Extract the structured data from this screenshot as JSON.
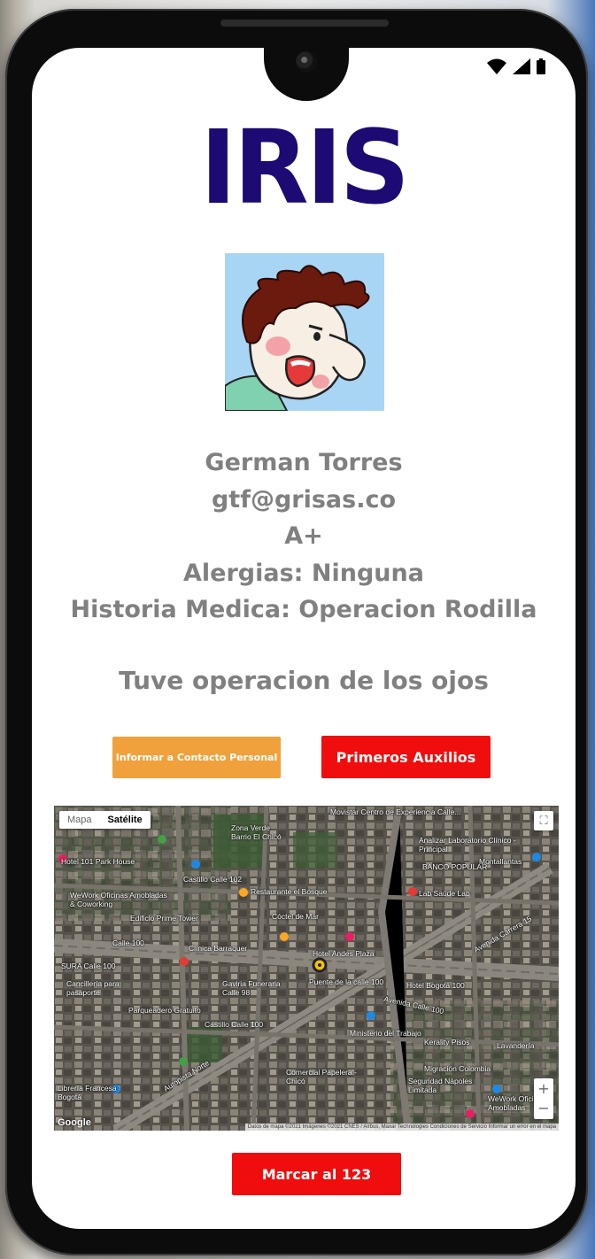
{
  "status_bar": {
    "icons": [
      "wifi-icon",
      "signal-icon",
      "battery-icon"
    ]
  },
  "app": {
    "title": "IRIS",
    "title_color": "#1d0a73"
  },
  "profile": {
    "name": "German Torres",
    "email": "gtf@grisas.co",
    "blood_type": "A+",
    "allergies": "Alergias: Ninguna",
    "medical_history": "Historia Medica: Operacion Rodilla",
    "note": "Tuve operacion de los ojos"
  },
  "actions": {
    "contact_label": "Informar a Contacto Personal",
    "contact_color": "#f0a13b",
    "first_aid_label": "Primeros Auxilios",
    "first_aid_color": "#f00d0d",
    "call_label": "Marcar al 123",
    "call_color": "#f00d0d"
  },
  "map": {
    "tab_map": "Mapa",
    "tab_satellite": "Satélite",
    "zoom_in": "+",
    "zoom_out": "−",
    "provider": "Google",
    "attribution": "Datos de mapa ©2021 Imágenes ©2021 CNES / Airbus, Maxar Technologies   Condiciones de Servicio   Informar un error en el mapa",
    "labels": [
      "Movistar Centro de Experiencia Calle...",
      "Hotel 101 Park House",
      "Zona Verde Barrio El Chicó",
      "Analizar Laboratorio Clínico - Principal",
      "BANCO POPULAR",
      "Montallantas",
      "Castillo Calle 102",
      "WeWork Oficinas Amobladas & Coworking",
      "Restaurante el Bosque",
      "Edificio Prime Tower",
      "Cóctel de Mar",
      "Clínica Barraquer",
      "SURA Calle 100",
      "Hotel Andes Plaza",
      "Puente de la calle 100",
      "Cancillería para pasaporte",
      "Gaviria Funeraria Calle 98",
      "Parqueadero Gratuito",
      "Hotel Bogotá 100",
      "Avenida Calle 100",
      "Ministerio del Trabajo",
      "Castillo Calle 100",
      "Kerality Pisos",
      "Migración Colombia",
      "Seguridad Nápoles Limitada",
      "Comercial Papelera - Chicó",
      "Librería Francesa Bogotá",
      "WeWork Oficinas Amobladas",
      "Autopista Norte",
      "Lab Saúde Lab",
      "Calle 100",
      "Avenida Carrera 15",
      "Lavandería"
    ]
  }
}
